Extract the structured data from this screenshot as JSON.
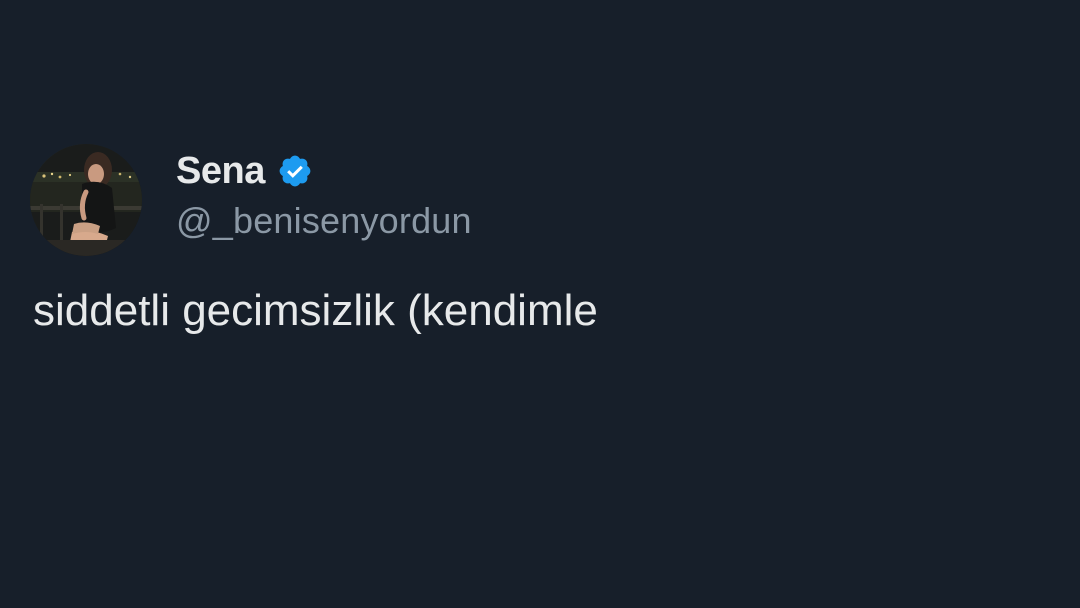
{
  "author": {
    "display_name": "Sena",
    "handle": "@_benisenyordun",
    "verified": true,
    "verified_color": "#1d9bf0",
    "avatar_icon": "profile-photo"
  },
  "tweet": {
    "text": "siddetli gecimsizlik (kendimle"
  },
  "colors": {
    "background": "#171f2a",
    "primary_text": "#e7e9ea",
    "secondary_text": "#8b98a5"
  }
}
